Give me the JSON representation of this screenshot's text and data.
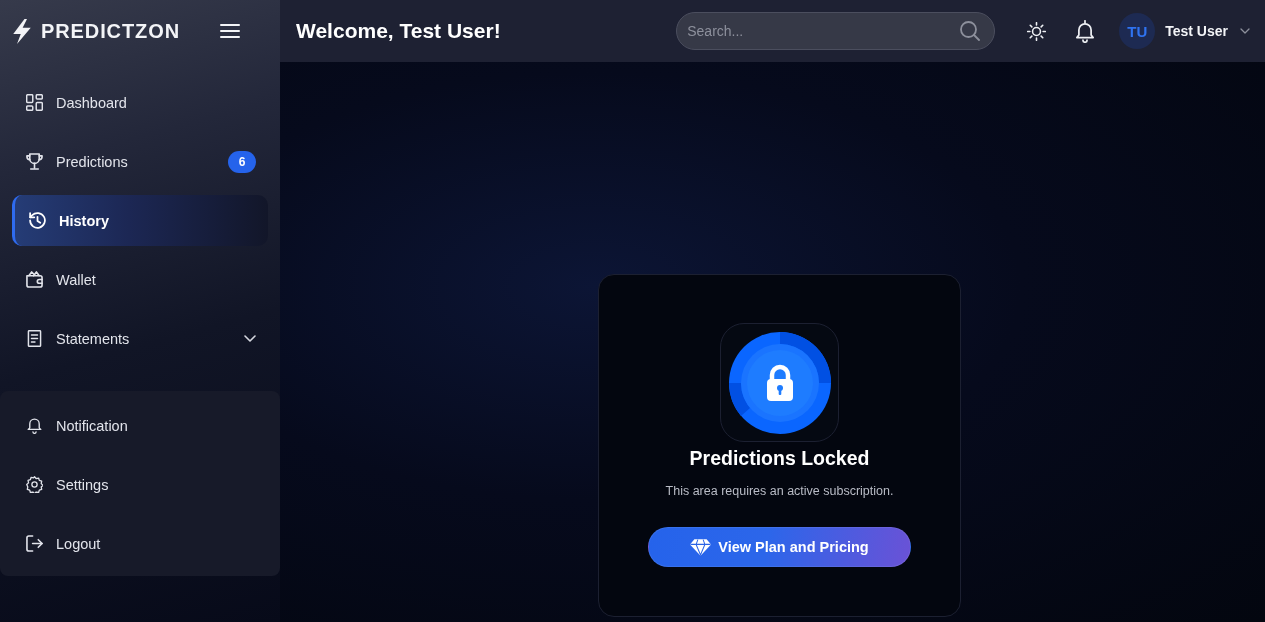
{
  "brand": {
    "name": "PREDICTZON"
  },
  "sidebar": {
    "items": [
      {
        "kind": "link",
        "label": "Dashboard",
        "selected": false
      },
      {
        "kind": "link",
        "label": "Predictions",
        "badge": "6",
        "selected": false
      },
      {
        "kind": "link",
        "label": "History",
        "selected": true
      },
      {
        "kind": "link",
        "label": "Wallet",
        "selected": false
      },
      {
        "kind": "group",
        "label": "Statements",
        "selected": false,
        "expanded": false
      }
    ],
    "bottom_items": [
      {
        "label": "Notification",
        "selected": false
      },
      {
        "label": "Settings",
        "selected": false
      },
      {
        "label": "Logout",
        "selected": false
      }
    ]
  },
  "header": {
    "title": "Welcome, Test User!",
    "search": {
      "placeholder": "Search..."
    },
    "user": {
      "initials": "TU",
      "name": "Test User"
    }
  },
  "locked_panel": {
    "title": "Predictions Locked",
    "message": "This area requires an active subscription.",
    "button": "View Plan and Pricing"
  }
}
